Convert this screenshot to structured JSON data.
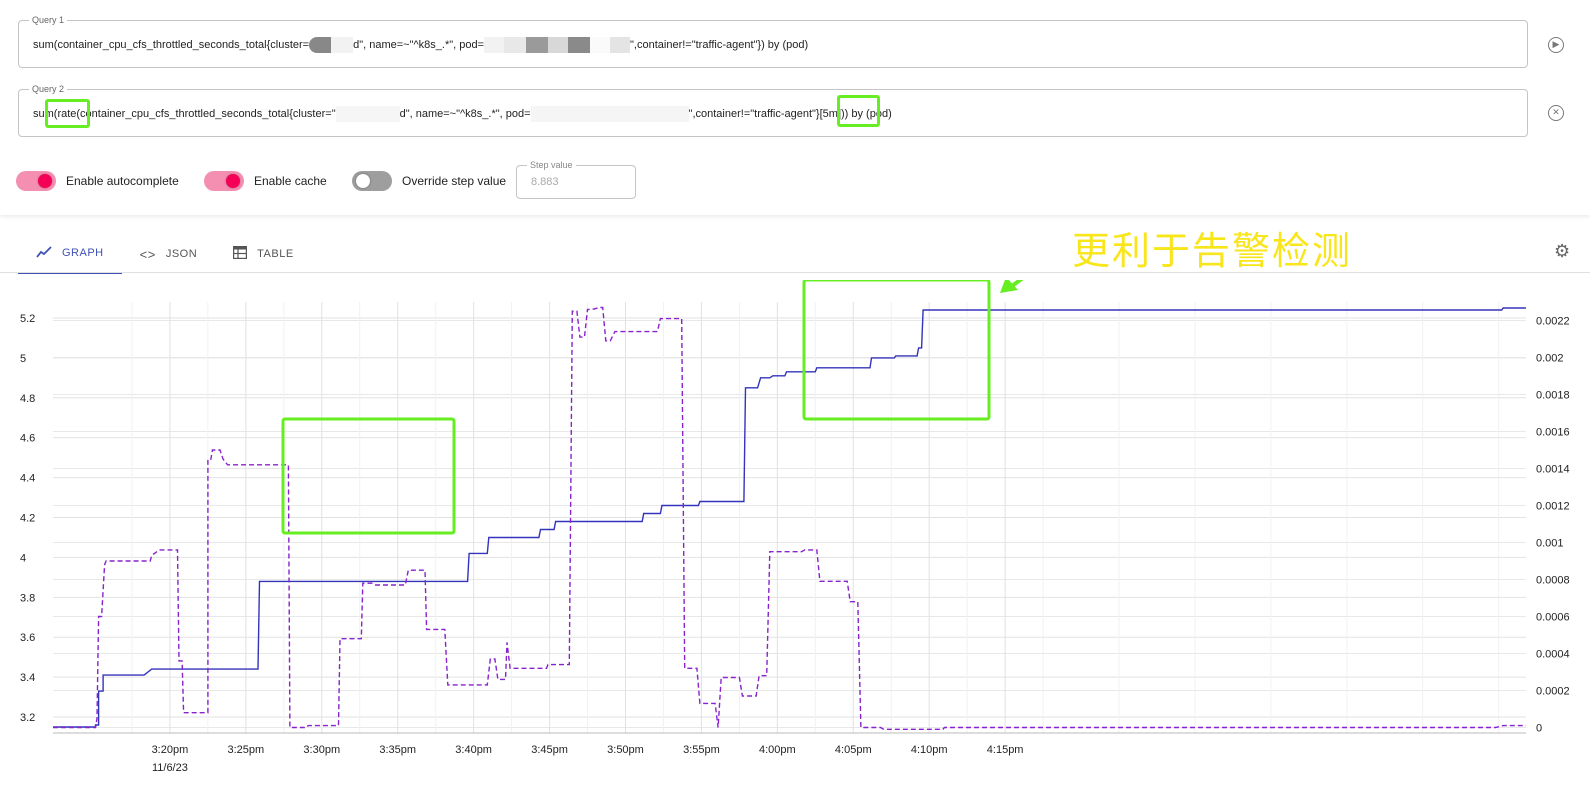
{
  "query1": {
    "legend": "Query 1",
    "text_a": "sum(container_cpu_cfs_throttled_seconds_total{cluster=",
    "text_b": "d\", name=~\"^k8s_.*\", pod=",
    "text_c": "\",container!=\"traffic-agent\"}) by (pod)",
    "action_icon": "play-circle-icon"
  },
  "query2": {
    "legend": "Query 2",
    "text_a": "sum(rate(container_cpu_cfs_throttled_seconds_total{cluster=\"",
    "text_b": "d\", name=~\"^k8s_.*\", pod=",
    "text_c": "\",container!=\"traffic-agent\"}[5m])) by (pod)",
    "action_icon": "close-circle-icon"
  },
  "options": {
    "autocomplete_label": "Enable autocomplete",
    "autocomplete_on": true,
    "cache_label": "Enable cache",
    "cache_on": true,
    "step_override_label": "Override step value",
    "step_override_on": false,
    "step_legend": "Step value",
    "step_value": "8.883"
  },
  "tabs": [
    {
      "label": "GRAPH",
      "icon": "graph-icon",
      "active": true
    },
    {
      "label": "JSON",
      "icon": "code-icon",
      "active": false
    },
    {
      "label": "TABLE",
      "icon": "table-icon",
      "active": false
    }
  ],
  "annotation_text": "更利于告警检测",
  "colors": {
    "accent": "#3f51b5",
    "toggle_on": "#f50057",
    "highlight": "#66ee22",
    "annotation": "#f8e51a",
    "series1": "#3333bb",
    "series2": "#8822cc"
  },
  "chart_data": {
    "type": "line",
    "x_ticks": [
      "3:20pm",
      "3:25pm",
      "3:30pm",
      "3:35pm",
      "3:40pm",
      "3:45pm",
      "3:50pm",
      "3:55pm",
      "4:00pm",
      "4:05pm",
      "4:10pm",
      "4:15pm"
    ],
    "x_date_label": "11/6/23",
    "x_range_minutes": [
      0,
      60
    ],
    "y_left_ticks": [
      "3.2",
      "3.4",
      "3.6",
      "3.8",
      "4",
      "4.2",
      "4.4",
      "4.6",
      "4.8",
      "5",
      "5.2"
    ],
    "y_left_range": [
      3.12,
      5.28
    ],
    "y_right_ticks": [
      "0",
      "0.0002",
      "0.0004",
      "0.0006",
      "0.0008",
      "0.001",
      "0.0012",
      "0.0014",
      "0.0016",
      "0.0018",
      "0.002",
      "0.0022"
    ],
    "y_right_range": [
      -3e-05,
      0.0023
    ],
    "grid": true,
    "series": [
      {
        "axis": "left",
        "style": "solid",
        "points": [
          [
            0,
            3.15
          ],
          [
            2.8,
            3.15
          ],
          [
            2.8,
            3.16
          ],
          [
            3,
            3.16
          ],
          [
            3,
            3.33
          ],
          [
            3.3,
            3.33
          ],
          [
            3.3,
            3.41
          ],
          [
            6,
            3.41
          ],
          [
            6.5,
            3.44
          ],
          [
            13.5,
            3.44
          ],
          [
            13.6,
            3.88
          ],
          [
            24.5,
            3.88
          ],
          [
            24.5,
            3.88
          ],
          [
            27.3,
            3.88
          ],
          [
            27.4,
            4.02
          ],
          [
            28.6,
            4.02
          ],
          [
            28.7,
            4.1
          ],
          [
            32,
            4.1
          ],
          [
            32.1,
            4.14
          ],
          [
            33,
            4.14
          ],
          [
            33.1,
            4.18
          ],
          [
            38.8,
            4.18
          ],
          [
            38.9,
            4.22
          ],
          [
            40,
            4.22
          ],
          [
            40.1,
            4.26
          ],
          [
            42.5,
            4.26
          ],
          [
            42.6,
            4.28
          ],
          [
            45.5,
            4.28
          ],
          [
            45.6,
            4.85
          ],
          [
            46.4,
            4.85
          ],
          [
            46.6,
            4.9
          ],
          [
            47.2,
            4.9
          ],
          [
            47.4,
            4.91
          ],
          [
            48.2,
            4.91
          ],
          [
            48.3,
            4.93
          ],
          [
            50.2,
            4.93
          ],
          [
            50.3,
            4.95
          ],
          [
            53.8,
            4.95
          ],
          [
            53.9,
            5
          ],
          [
            55.4,
            5
          ],
          [
            55.5,
            5.01
          ],
          [
            56.9,
            5.01
          ],
          [
            57,
            5.05
          ],
          [
            57.2,
            5.05
          ],
          [
            57.3,
            5.24
          ],
          [
            95.4,
            5.24
          ],
          [
            95.5,
            5.25
          ],
          [
            97,
            5.25
          ]
        ]
      },
      {
        "axis": "right",
        "style": "dashed",
        "points": [
          [
            0,
            0
          ],
          [
            2.8,
            0
          ],
          [
            2.9,
            5e-05
          ],
          [
            3.0,
            0.0006
          ],
          [
            3.2,
            0.0006
          ],
          [
            3.4,
            0.00088
          ],
          [
            3.5,
            0.0009
          ],
          [
            6.4,
            0.0009
          ],
          [
            6.5,
            0.00093
          ],
          [
            7.0,
            0.00096
          ],
          [
            8.2,
            0.00096
          ],
          [
            8.3,
            0.00036
          ],
          [
            8.5,
            0.00036
          ],
          [
            8.6,
            8e-05
          ],
          [
            10.2,
            8e-05
          ],
          [
            10.2,
            0.00145
          ],
          [
            10.4,
            0.00145
          ],
          [
            10.5,
            0.0015
          ],
          [
            11.0,
            0.0015
          ],
          [
            11.2,
            0.00145
          ],
          [
            11.5,
            0.00142
          ],
          [
            15.5,
            0.00142
          ],
          [
            15.6,
            0.0
          ],
          [
            16.7,
            0.0
          ],
          [
            16.8,
            1e-05
          ],
          [
            18.8,
            1e-05
          ],
          [
            18.9,
            0.00048
          ],
          [
            20.3,
            0.00048
          ],
          [
            20.4,
            0.00078
          ],
          [
            21,
            0.00078
          ],
          [
            21.2,
            0.00077
          ],
          [
            23.2,
            0.00077
          ],
          [
            23.4,
            0.00085
          ],
          [
            24.5,
            0.00085
          ],
          [
            24.6,
            0.00053
          ],
          [
            25.8,
            0.00053
          ],
          [
            26,
            0.00023
          ],
          [
            28.6,
            0.00023
          ],
          [
            28.8,
            0.00037
          ],
          [
            29.1,
            0.00037
          ],
          [
            29.3,
            0.00026
          ],
          [
            29.6,
            0.00026
          ],
          [
            29.8,
            0.00026
          ],
          [
            29.9,
            0.00046
          ],
          [
            30.1,
            0.00032
          ],
          [
            32.5,
            0.00032
          ],
          [
            32.6,
            0.00034
          ],
          [
            34.0,
            0.00034
          ],
          [
            34.2,
            0.00225
          ],
          [
            34.5,
            0.00225
          ],
          [
            34.7,
            0.00211
          ],
          [
            35.0,
            0.00211
          ],
          [
            35.2,
            0.00226
          ],
          [
            35.5,
            0.00226
          ],
          [
            36.0,
            0.00227
          ],
          [
            36.2,
            0.00227
          ],
          [
            36.4,
            0.00209
          ],
          [
            36.7,
            0.00209
          ],
          [
            37.0,
            0.00214
          ],
          [
            39.8,
            0.00214
          ],
          [
            40.0,
            0.00221
          ],
          [
            41.4,
            0.00221
          ],
          [
            41.6,
            0.00032
          ],
          [
            42.4,
            0.00032
          ],
          [
            42.6,
            0.00013
          ],
          [
            43.6,
            0.00013
          ],
          [
            43.8,
            0.0
          ],
          [
            44.0,
            0.00027
          ],
          [
            45.2,
            0.00027
          ],
          [
            45.4,
            0.00017
          ],
          [
            46.3,
            0.00017
          ],
          [
            46.5,
            0.00028
          ],
          [
            47.0,
            0.00028
          ],
          [
            47.2,
            0.00095
          ],
          [
            49.3,
            0.00095
          ],
          [
            49.5,
            0.00096
          ],
          [
            50.3,
            0.00096
          ],
          [
            50.5,
            0.00079
          ],
          [
            52.3,
            0.00079
          ],
          [
            52.5,
            0.00068
          ],
          [
            53.0,
            0.00068
          ],
          [
            53.2,
            0.0
          ],
          [
            54.5,
            0.0
          ],
          [
            54.7,
            -1e-05
          ],
          [
            58.6,
            -1e-05
          ],
          [
            58.7,
            0.0
          ],
          [
            62,
            0.0
          ],
          [
            64,
            0.0
          ],
          [
            95,
            0.0
          ],
          [
            95.5,
            1e-05
          ],
          [
            97,
            1e-05
          ]
        ]
      }
    ]
  }
}
